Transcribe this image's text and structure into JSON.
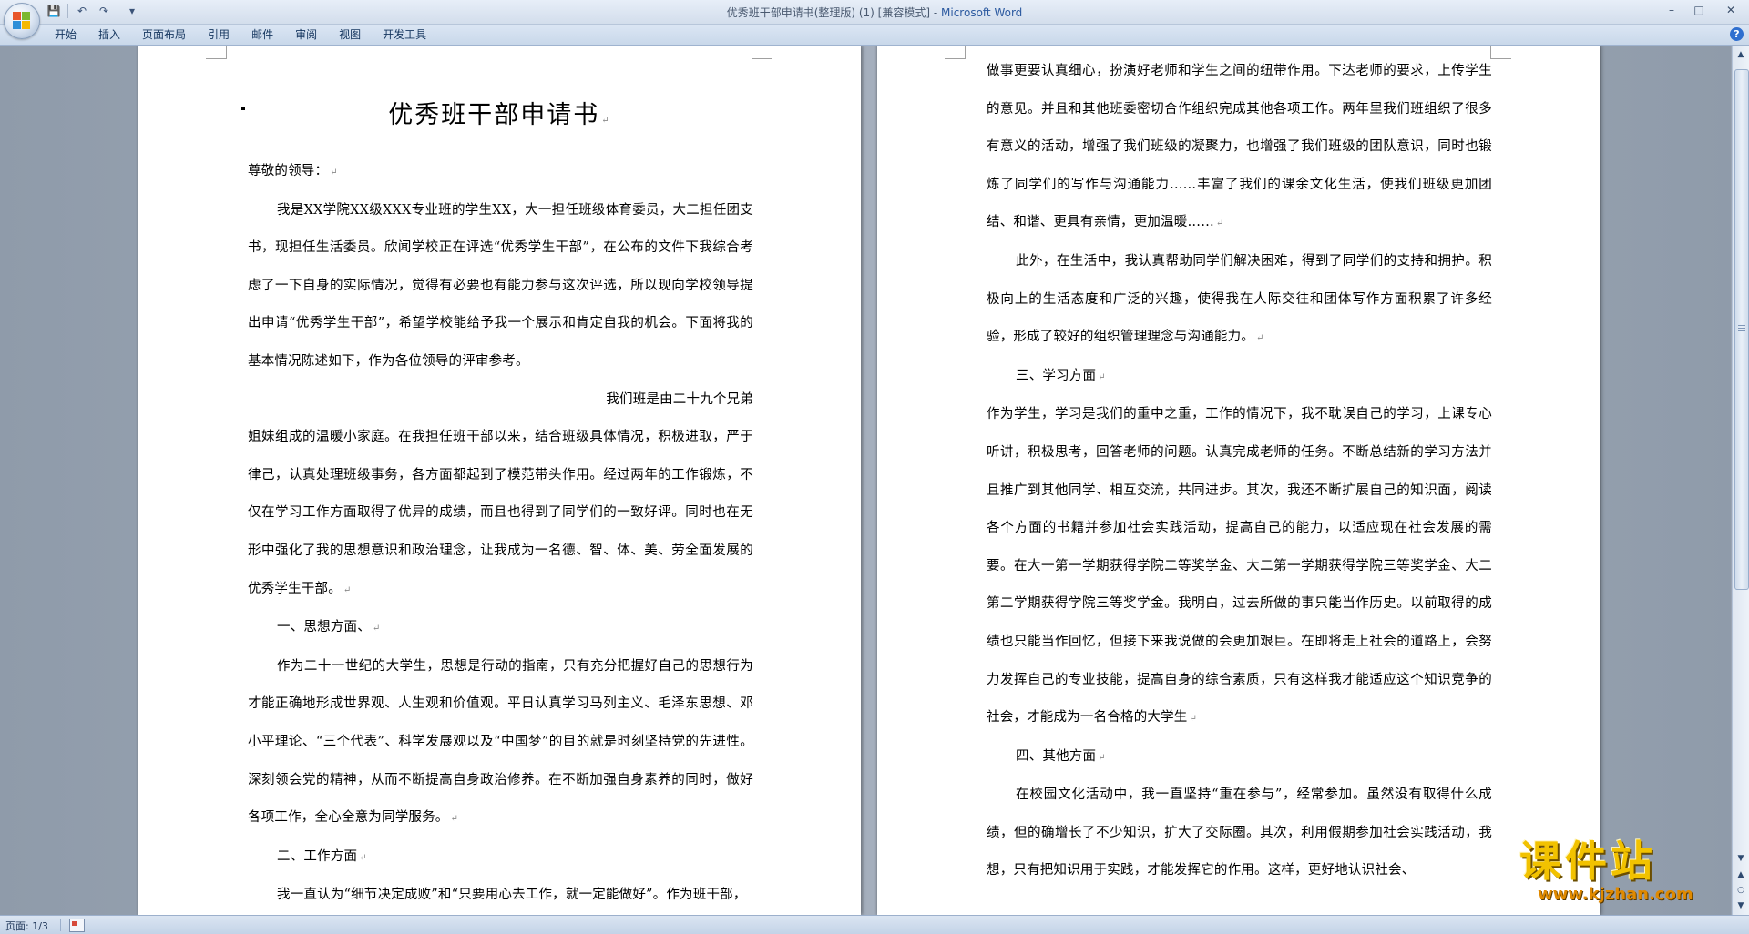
{
  "window": {
    "title": "优秀班干部申请书(整理版) (1) [兼容模式] - ",
    "app_name": "Microsoft Word",
    "minimize": "–",
    "maximize": "□",
    "close": "✕"
  },
  "qat": {
    "save": "💾",
    "undo": "↶",
    "redo": "↷",
    "more": "▾"
  },
  "ribbon_tabs": [
    "开始",
    "插入",
    "页面布局",
    "引用",
    "邮件",
    "审阅",
    "视图",
    "开发工具"
  ],
  "help": "?",
  "doc": {
    "title": "优秀班干部申请书",
    "left_paragraphs": [
      "尊敬的领导：",
      "我是XX学院XX级XXX专业班的学生XX，大一担任班级体育委员，大二担任团支书，现担任生活委员。欣闻学校正在评选“优秀学生干部”，在公布的文件下我综合考虑了一下自身的实际情况，觉得有必要也有能力参与这次评选，所以现向学校领导提出申请“优秀学生干部”，希望学校能给予我一个展示和肯定自我的机会。下面将我的基本情况陈述如下，作为各位领导的评审参考。",
      "我们班是由二十九个兄弟",
      "姐妹组成的温暖小家庭。在我担任班干部以来，结合班级具体情况，积极进取，严于律己，认真处理班级事务，各方面都起到了模范带头作用。经过两年的工作锻炼，不仅在学习工作方面取得了优异的成绩，而且也得到了同学们的一致好评。同时也在无形中强化了我的思想意识和政治理念，让我成为一名德、智、体、美、劳全面发展的优秀学生干部。",
      "一、思想方面、",
      "作为二十一世纪的大学生，思想是行动的指南，只有充分把握好自己的思想行为才能正确地形成世界观、人生观和价值观。平日认真学习马列主义、毛泽东思想、邓小平理论、“三个代表”、科学发展观以及“中国梦”的目的就是时刻坚持党的先进性。深刻领会党的精神，从而不断提高自身政治修养。在不断加强自身素养的同时，做好各项工作，全心全意为同学服务。",
      "二、工作方面",
      "我一直认为“细节决定成败”和“只要用心去工作，就一定能做好”。作为班干部，"
    ],
    "right_paragraphs": [
      "做事更要认真细心，扮演好老师和学生之间的纽带作用。下达老师的要求，上传学生的意见。并且和其他班委密切合作组织完成其他各项工作。两年里我们班组织了很多有意义的活动，增强了我们班级的凝聚力，也增强了我们班级的团队意识，同时也锻炼了同学们的写作与沟通能力……丰富了我们的课余文化生活，使我们班级更加团结、和谐、更具有亲情，更加温暖……",
      "此外，在生活中，我认真帮助同学们解决困难，得到了同学们的支持和拥护。积极向上的生活态度和广泛的兴趣，使得我在人际交往和团体写作方面积累了许多经验，形成了较好的组织管理理念与沟通能力。",
      "三、学习方面",
      "作为学生，学习是我们的重中之重，工作的情况下，我不耽误自己的学习，上课专心听讲，积极思考，回答老师的问题。认真完成老师的任务。不断总结新的学习方法并且推广到其他同学、相互交流，共同进步。其次，我还不断扩展自己的知识面，阅读各个方面的书籍并参加社会实践活动，提高自己的能力，以适应现在社会发展的需要。在大一第一学期获得学院二等奖学金、大二第一学期获得学院三等奖学金、大二第二学期获得学院三等奖学金。我明白，过去所做的事只能当作历史。以前取得的成绩也只能当作回忆，但接下来我说做的会更加艰巨。在即将走上社会的道路上，会努力发挥自己的专业技能，提高自身的综合素质，只有这样我才能适应这个知识竞争的社会，才能成为一名合格的大学生",
      "四、其他方面",
      "在校园文化活动中，我一直坚持“重在参与”，经常参加。虽然没有取得什么成绩，但的确增长了不少知识，扩大了交际圈。其次，利用假期参加社会实践活动，我想，只有把知识用于实践，才能发挥它的作用。这样，更好地认识社会、"
    ],
    "para_mark": "↵"
  },
  "statusbar": {
    "page": "页面: 1/3"
  },
  "watermark": {
    "cn": "课件站",
    "url": "www.kjzhan.com"
  },
  "scrollbar": {
    "up": "▲",
    "down": "▼",
    "prev": "▲",
    "next": "▼",
    "browse": "○"
  }
}
